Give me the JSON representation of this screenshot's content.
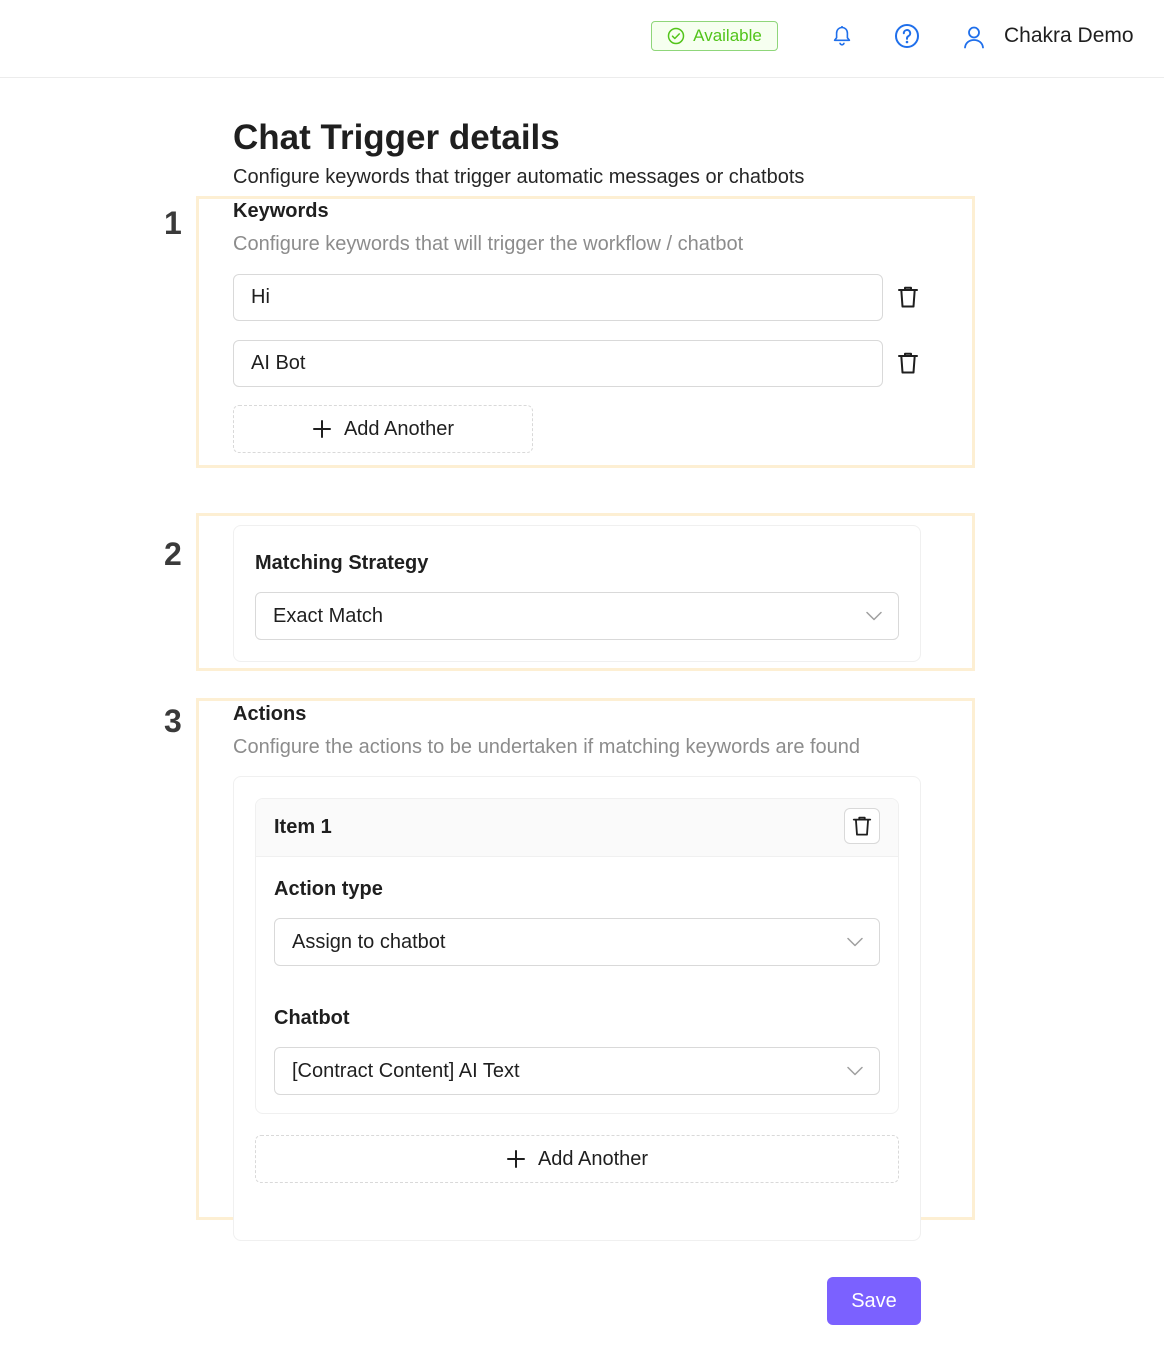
{
  "header": {
    "status": "Available",
    "user_name": "Chakra Demo"
  },
  "page": {
    "title": "Chat Trigger details",
    "subtitle": "Configure keywords that trigger automatic messages or chatbots"
  },
  "steps": [
    "1",
    "2",
    "3"
  ],
  "keywords": {
    "title": "Keywords",
    "description": "Configure keywords that will trigger the workflow / chatbot",
    "items": [
      "Hi",
      "AI Bot"
    ],
    "add_label": "Add Another"
  },
  "matching": {
    "label": "Matching Strategy",
    "value": "Exact Match"
  },
  "actions": {
    "title": "Actions",
    "description": "Configure the actions to be undertaken if matching keywords are found",
    "item": {
      "title": "Item 1",
      "action_type_label": "Action type",
      "action_type_value": "Assign to chatbot",
      "chatbot_label": "Chatbot",
      "chatbot_value": "[Contract Content] AI Text"
    },
    "add_label": "Add Another"
  },
  "save_label": "Save",
  "colors": {
    "accent": "#7b61ff",
    "status_green": "#52c41a",
    "icon_blue": "#1f6feb",
    "highlight": "#fdefd3"
  },
  "icons": {
    "status": "check-circle-icon",
    "notifications": "bell-icon",
    "help": "help-circle-icon",
    "user": "user-icon",
    "delete": "trash-icon",
    "add": "plus-icon",
    "dropdown": "chevron-down-icon"
  }
}
